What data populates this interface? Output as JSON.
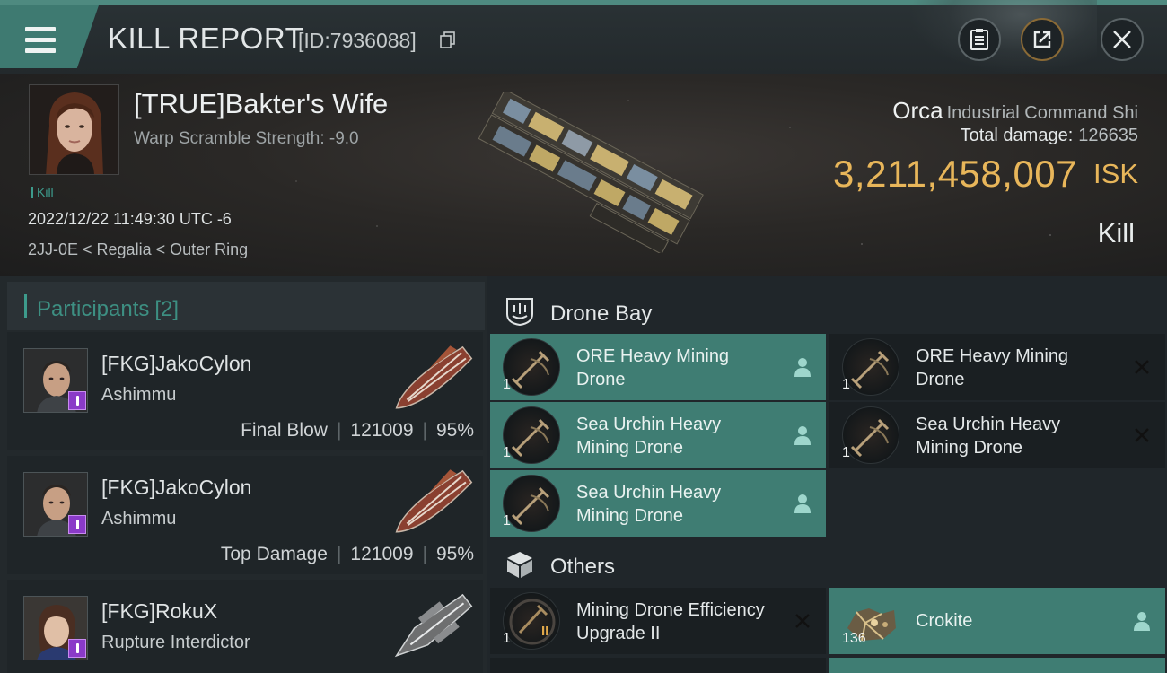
{
  "header": {
    "title": "KILL REPORT",
    "report_id": "[ID:7936088]",
    "menu_icon": "hamburger-icon",
    "clipboard_icon": "clipboard-icon",
    "share_icon": "share-icon",
    "close_icon": "close-icon"
  },
  "victim": {
    "name": "[TRUE]Bakter's Wife",
    "warp_scramble": "Warp Scramble Strength: -9.0",
    "tag": "Kill",
    "datetime": "2022/12/22 11:49:30 UTC -6",
    "location": "2JJ-0E < Regalia < Outer Ring",
    "ship_name": "Orca",
    "ship_class": "Industrial Command Shi",
    "total_damage_label": "Total damage:",
    "total_damage": "126635",
    "isk_value": "3,211,458,007",
    "isk_unit": "ISK",
    "result": "Kill"
  },
  "participants": {
    "label": "Participants",
    "count": "[2]",
    "items": [
      {
        "name": "[FKG]JakoCylon",
        "ship": "Ashimmu",
        "role": "Final Blow",
        "damage": "121009",
        "percent": "95%"
      },
      {
        "name": "[FKG]JakoCylon",
        "ship": "Ashimmu",
        "role": "Top Damage",
        "damage": "121009",
        "percent": "95%"
      },
      {
        "name": "[FKG]RokuX",
        "ship": "Rupture Interdictor"
      }
    ]
  },
  "drone_bay": {
    "label": "Drone Bay",
    "icon": "drone-bay-icon",
    "items": [
      {
        "name": "ORE Heavy Mining Drone",
        "qty": "1",
        "status": "dropped"
      },
      {
        "name": "ORE Heavy Mining Drone",
        "qty": "1",
        "status": "destroyed"
      },
      {
        "name": "Sea Urchin Heavy Mining Drone",
        "qty": "1",
        "status": "dropped"
      },
      {
        "name": "Sea Urchin Heavy Mining Drone",
        "qty": "1",
        "status": "destroyed"
      },
      {
        "name": "Sea Urchin Heavy Mining Drone",
        "qty": "1",
        "status": "dropped"
      }
    ]
  },
  "others": {
    "label": "Others",
    "icon": "cargo-box-icon",
    "items": [
      {
        "name": "Mining Drone Efficiency Upgrade II",
        "qty": "1",
        "meta": "II",
        "status": "destroyed"
      },
      {
        "name": "Crokite",
        "qty": "136",
        "status": "dropped"
      }
    ]
  },
  "colors": {
    "accent_teal": "#3d9b8c",
    "dropped_bg": "#3f7d73",
    "isk_gold": "#e8b65a"
  }
}
